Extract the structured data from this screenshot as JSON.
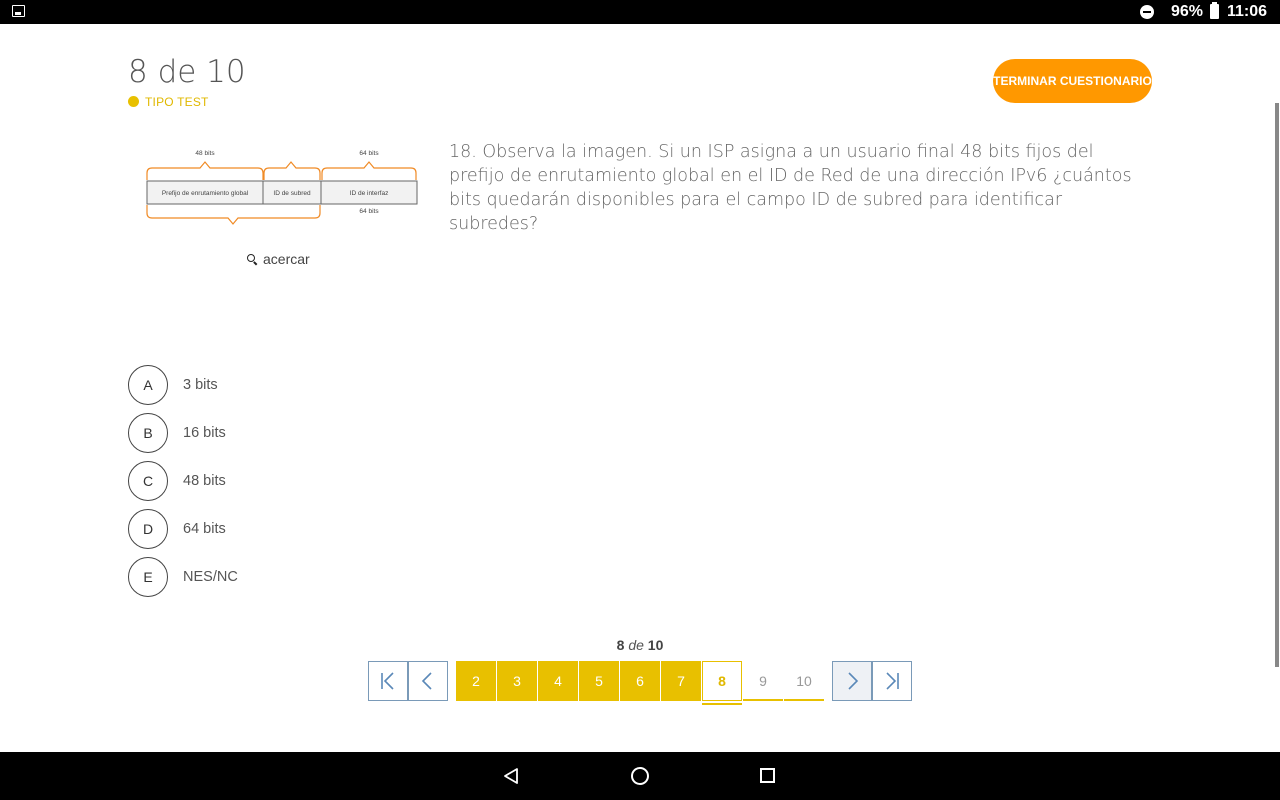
{
  "status_bar": {
    "battery_percent": "96%",
    "time": "11:06",
    "icons": [
      "notification-image-icon",
      "do-not-disturb-icon",
      "battery-icon"
    ]
  },
  "header": {
    "counter": "8 de 10",
    "type_label": "TIPO TEST",
    "finish_button": "TERMINAR CUESTIONARIO"
  },
  "colors": {
    "accent_yellow": "#e8c000",
    "finish_orange": "#ff9800",
    "diagram_orange": "#f08a24",
    "nav_border": "#7a9ab8"
  },
  "diagram": {
    "top_left_label": "48 bits",
    "top_right_label": "64 bits",
    "bottom_right_label": "64 bits",
    "field_1": "Prefijo de enrutamiento global",
    "field_2": "ID de subred",
    "field_3": "ID de interfaz"
  },
  "zoom": {
    "label": "acercar",
    "icon": "search-icon"
  },
  "question": {
    "text": "18. Observa la imagen. Si un ISP asigna a un usuario final 48 bits fijos del prefijo de enrutamiento global en el ID de Red de una dirección IPv6 ¿cuántos bits quedarán disponibles para el campo ID de subred para identificar subredes?"
  },
  "options": [
    {
      "letter": "A",
      "text": "3 bits"
    },
    {
      "letter": "B",
      "text": "16 bits"
    },
    {
      "letter": "C",
      "text": "48 bits"
    },
    {
      "letter": "D",
      "text": "64 bits"
    },
    {
      "letter": "E",
      "text": "NES/NC"
    }
  ],
  "pagination": {
    "current": "8",
    "of": "de",
    "total": "10",
    "pages": [
      "2",
      "3",
      "4",
      "5",
      "6",
      "7",
      "8",
      "9",
      "10"
    ],
    "answered": [
      "2",
      "3",
      "4",
      "5",
      "6",
      "7"
    ],
    "future": [
      "9",
      "10"
    ]
  },
  "navbar": {
    "icons": [
      "back-icon",
      "home-icon",
      "recents-icon"
    ]
  }
}
